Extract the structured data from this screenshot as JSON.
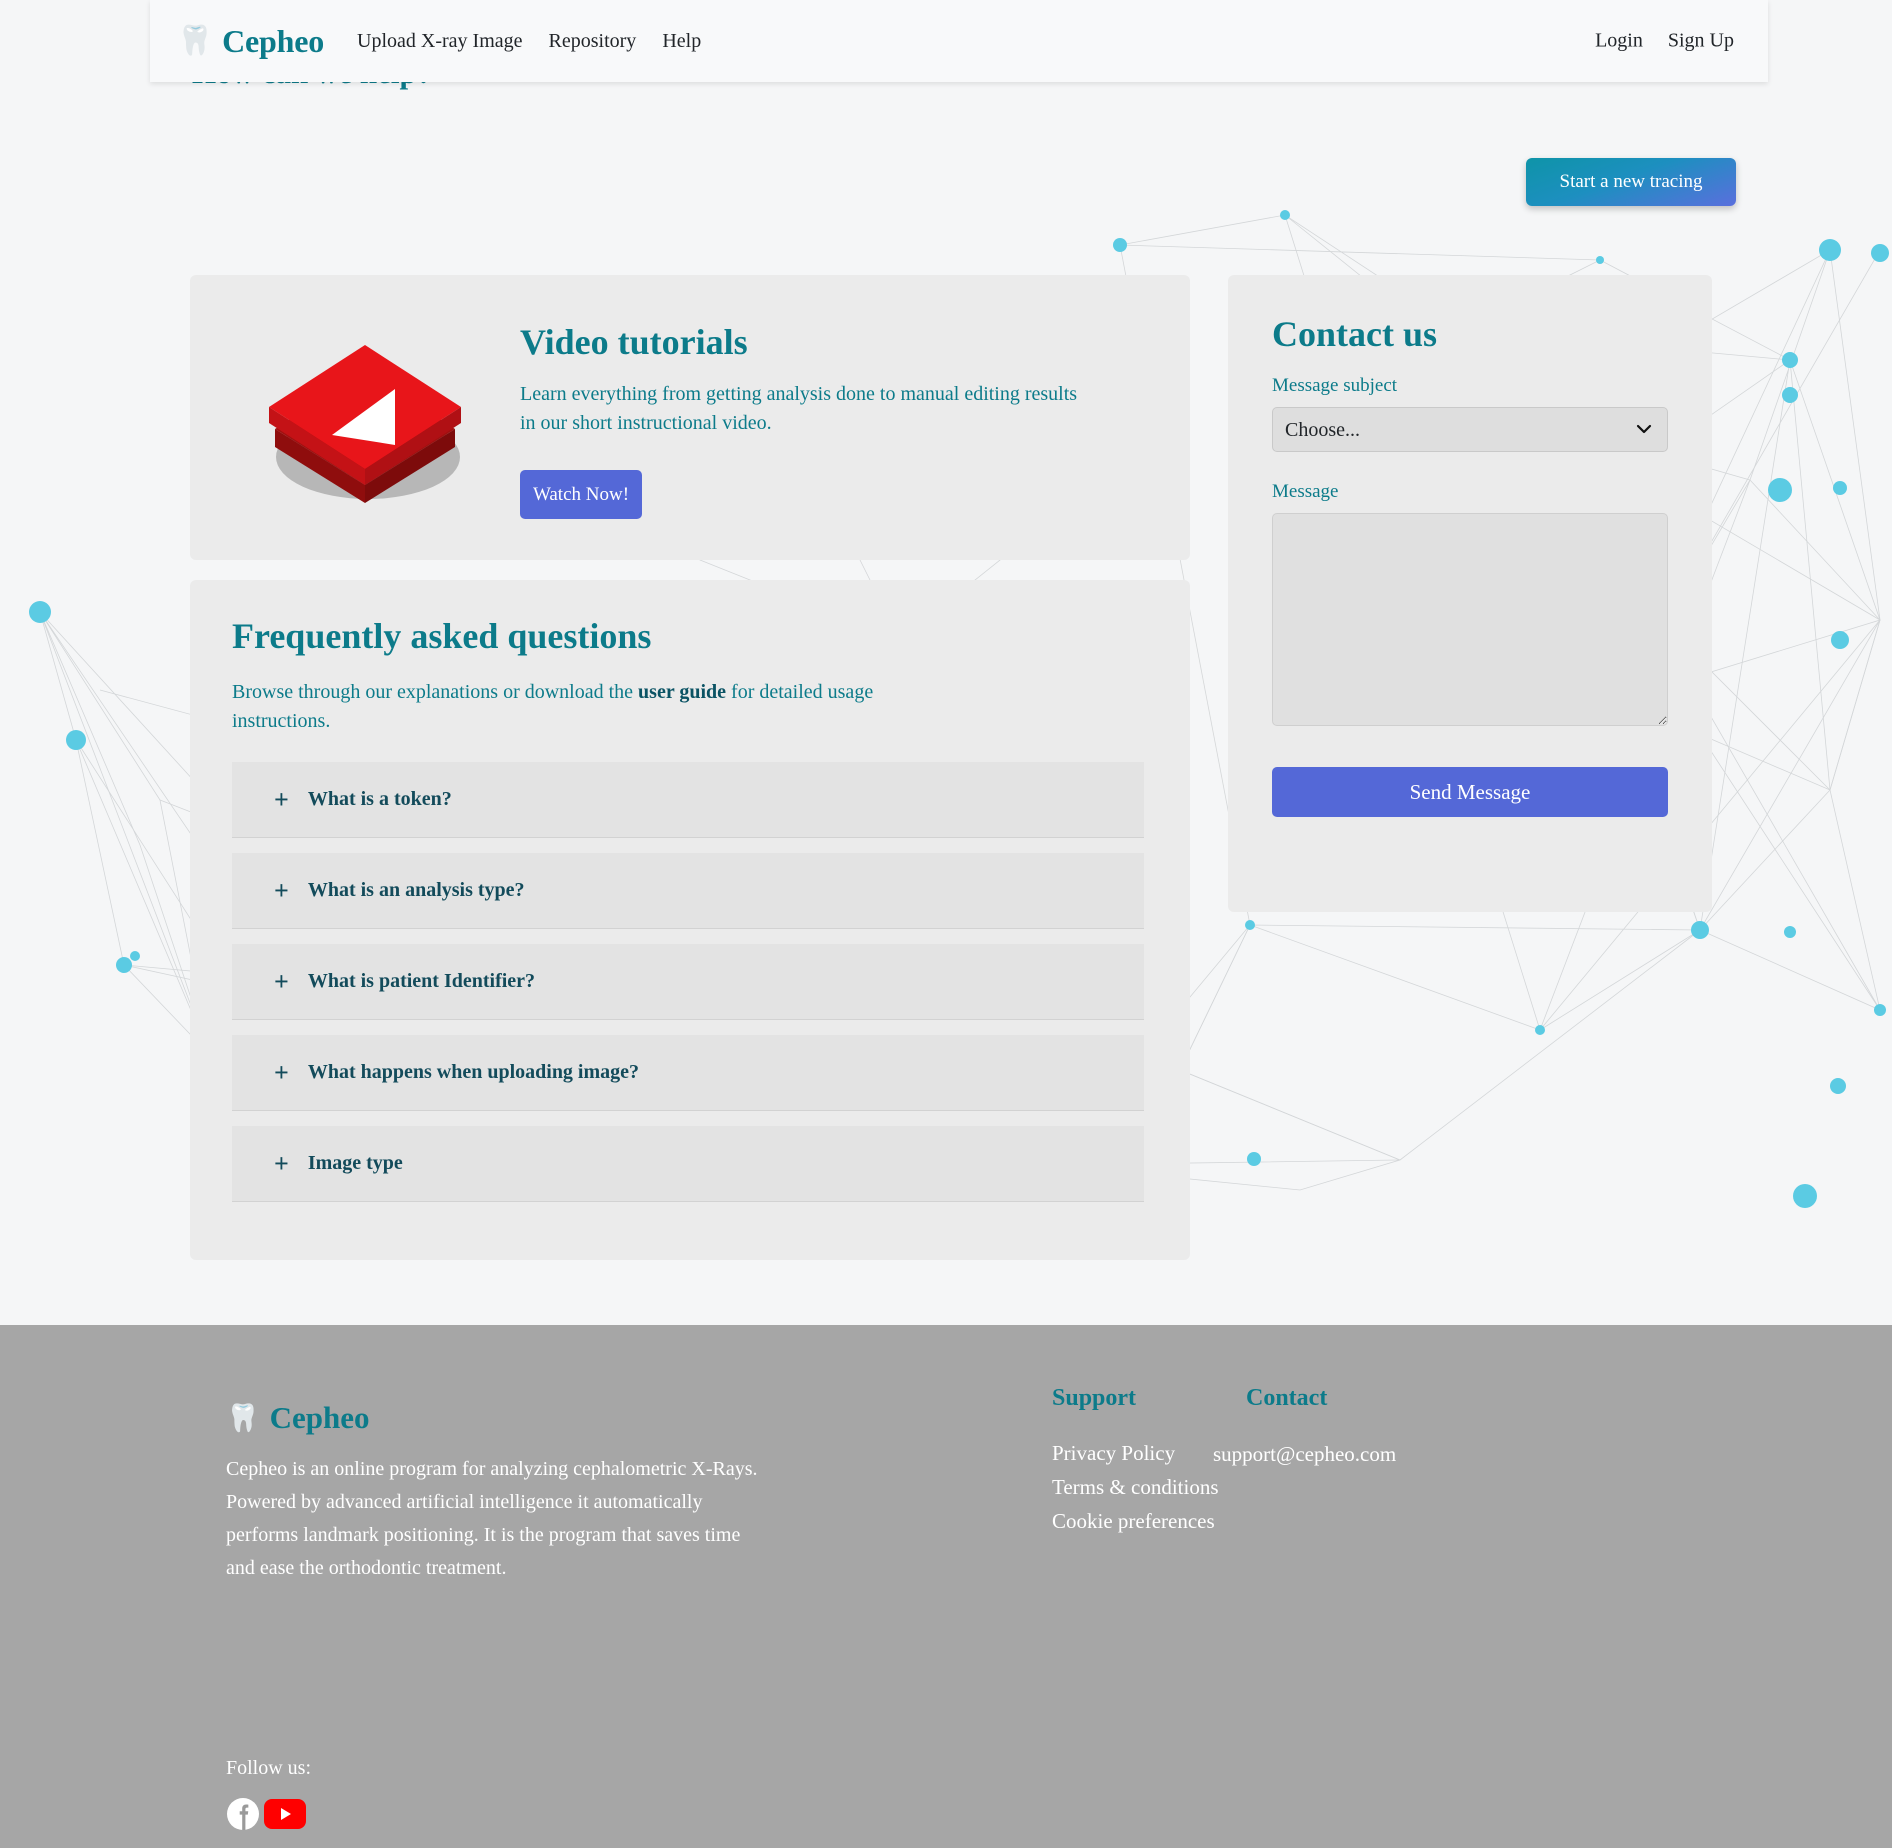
{
  "navbar": {
    "brand": "Cepheo",
    "brand_icon": "tooth-icon",
    "links": [
      {
        "label": "Upload X-ray Image"
      },
      {
        "label": "Repository"
      },
      {
        "label": "Help"
      }
    ],
    "auth": [
      {
        "label": "Login"
      },
      {
        "label": "Sign Up"
      }
    ]
  },
  "header": {
    "title": "How can we help?",
    "start_tracing_label": "Start a new tracing"
  },
  "video_card": {
    "icon": "video-play-cube-icon",
    "title": "Video tutorials",
    "description": "Learn everything from getting analysis done to manual editing results in our short instructional video.",
    "watch_label": "Watch Now!"
  },
  "faq_card": {
    "title": "Frequently asked questions",
    "subtitle_before": "Browse through our explanations or download the ",
    "subtitle_link": "user guide",
    "subtitle_after": " for detailed usage instructions.",
    "items": [
      {
        "label": "What is a token?",
        "icon": "plus-icon"
      },
      {
        "label": "What is an analysis type?",
        "icon": "plus-icon"
      },
      {
        "label": "What is patient Identifier?",
        "icon": "plus-icon"
      },
      {
        "label": "What happens when uploading image?",
        "icon": "plus-icon"
      },
      {
        "label": "Image type",
        "icon": "plus-icon"
      }
    ]
  },
  "contact_card": {
    "title": "Contact us",
    "subject_label": "Message subject",
    "subject_value": "Choose...",
    "subject_chevron": "chevron-down-icon",
    "message_label": "Message",
    "message_value": "",
    "message_placeholder": "",
    "send_label": "Send Message"
  },
  "footer": {
    "brand": "Cepheo",
    "brand_icon": "tooth-icon",
    "description": "Cepheo is an online program for analyzing cephalometric X-Rays. Powered by advanced artificial intelligence it automatically performs landmark positioning. It is the program that saves time and ease the orthodontic treatment.",
    "follow_label": "Follow us:",
    "social": [
      {
        "name": "facebook-icon"
      },
      {
        "name": "youtube-icon"
      }
    ],
    "support": {
      "title": "Support",
      "links": [
        {
          "label": "Privacy Policy"
        },
        {
          "label": "Terms & conditions"
        },
        {
          "label": "Cookie preferences"
        }
      ]
    },
    "contact": {
      "title": "Contact",
      "email": "support@cepheo.com"
    }
  },
  "colors": {
    "brand_teal": "#0c7b8a",
    "accent_blue": "#5468d7",
    "page_bg": "#f5f6f7",
    "card_bg": "#ebebeb",
    "faq_item_bg": "#e3e3e3",
    "footer_bg": "#a6a6a6",
    "network_dot": "#5bcbe3",
    "youtube_red": "#ff0000"
  }
}
